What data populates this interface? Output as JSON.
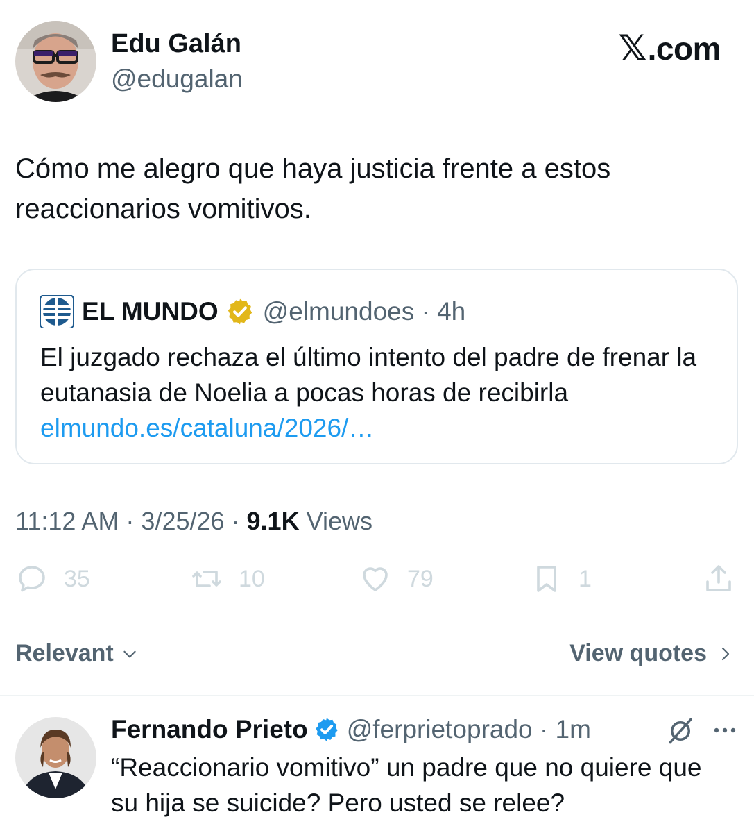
{
  "tweet": {
    "author_name": "Edu Galán",
    "author_handle": "@edugalan",
    "brand": "X.com",
    "brand_mark": "𝕏",
    "brand_text": ".com",
    "text": "Cómo me alegro que haya justicia frente a estos reaccionarios vomitivos.",
    "timestamp": "11:12 AM · 3/25/26 · ",
    "views_count": "9.1K",
    "views_label": " Views"
  },
  "quote": {
    "source_name": "EL MUNDO",
    "source_handle": "@elmundoes · 4h",
    "text": "El juzgado rechaza el último intento del padre de frenar la eutanasia de Noelia a pocas horas de recibirla",
    "link": "elmundo.es/cataluna/2026/…"
  },
  "actions": {
    "replies": "35",
    "reposts": "10",
    "likes": "79",
    "bookmarks": "1"
  },
  "controls": {
    "sort_label": "Relevant",
    "view_quotes_label": "View quotes"
  },
  "reply": {
    "author_name": "Fernando Prieto",
    "author_handle": "@ferprietoprado · 1m",
    "text": "“Reaccionario vomitivo” un padre que no quiere que su hija se suicide? Pero usted se relee?"
  },
  "colors": {
    "primary_text": "#0f1419",
    "secondary_text": "#536471",
    "link": "#1d9bf0",
    "verified_blue": "#1d9bf0",
    "verified_gold": "#e2b719",
    "action_icons": "#cfd9de"
  }
}
